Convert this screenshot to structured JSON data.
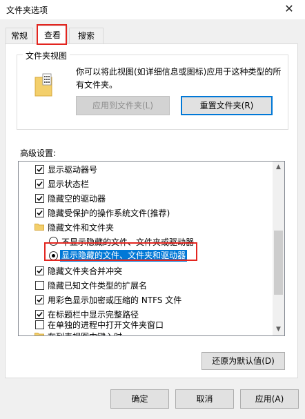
{
  "window": {
    "title": "文件夹选项",
    "close_glyph": "✕"
  },
  "tabs": [
    {
      "label": "常规"
    },
    {
      "label": "查看"
    },
    {
      "label": "搜索"
    }
  ],
  "folder_views": {
    "title": "文件夹视图",
    "description": "你可以将此视图(如详细信息或图标)应用于这种类型的所有文件夹。",
    "apply_button": "应用到文件夹(L)",
    "reset_button": "重置文件夹(R)"
  },
  "advanced": {
    "label": "高级设置:",
    "items": [
      {
        "type": "checkbox",
        "checked": true,
        "label": "显示驱动器号"
      },
      {
        "type": "checkbox",
        "checked": true,
        "label": "显示状态栏"
      },
      {
        "type": "checkbox",
        "checked": true,
        "label": "隐藏空的驱动器"
      },
      {
        "type": "checkbox",
        "checked": true,
        "label": "隐藏受保护的操作系统文件(推荐)"
      },
      {
        "type": "folder",
        "label": "隐藏文件和文件夹"
      },
      {
        "type": "radio",
        "checked": false,
        "label": "不显示隐藏的文件、文件夹或驱动器"
      },
      {
        "type": "radio",
        "checked": true,
        "label": "显示隐藏的文件、文件夹和驱动器"
      },
      {
        "type": "checkbox",
        "checked": true,
        "label": "隐藏文件夹合并冲突"
      },
      {
        "type": "checkbox",
        "checked": false,
        "label": "隐藏已知文件类型的扩展名"
      },
      {
        "type": "checkbox",
        "checked": true,
        "label": "用彩色显示加密或压缩的 NTFS 文件"
      },
      {
        "type": "checkbox",
        "checked": true,
        "label": "在标题栏中显示完整路径"
      },
      {
        "type": "checkbox",
        "checked": false,
        "label": "在单独的进程中打开文件夹窗口"
      },
      {
        "type": "folder",
        "label": "在列表视图中键入时"
      }
    ],
    "restore_button": "还原为默认值(D)"
  },
  "footer": {
    "ok": "确定",
    "cancel": "取消",
    "apply": "应用(A)"
  },
  "colors": {
    "accent": "#0078d7",
    "highlight_box": "#e3251f",
    "folder": "#f3cf6b"
  }
}
